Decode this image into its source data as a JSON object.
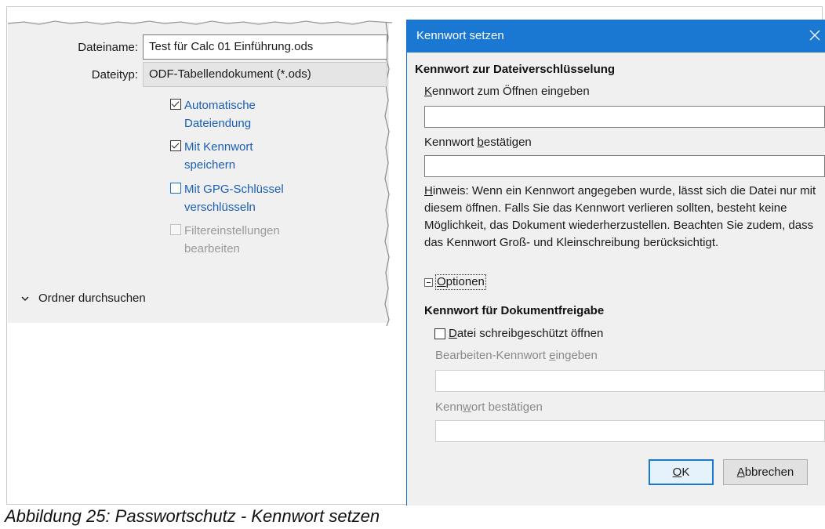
{
  "save_dialog": {
    "filename_label": "Dateiname:",
    "filename_value": "Test für Calc 01 Einführung.ods",
    "filetype_label": "Dateityp:",
    "filetype_value": "ODF-Tabellendokument (*.ods)",
    "options": [
      {
        "line1": "Automatische",
        "line2": "Dateiendung",
        "checked": true,
        "state": "enabled"
      },
      {
        "line1": "Mit Kennwort",
        "line2": "speichern",
        "checked": true,
        "state": "enabled"
      },
      {
        "line1": "Mit GPG-Schlüssel",
        "line2": "verschlüsseln",
        "checked": false,
        "state": "enabled"
      },
      {
        "line1": "Filtereinstellungen",
        "line2": "bearbeiten",
        "checked": false,
        "state": "disabled"
      }
    ],
    "browse_label": "Ordner durchsuchen"
  },
  "password_dialog": {
    "title": "Kennwort setzen",
    "section_encryption": "Kennwort zur Dateiverschlüsselung",
    "open_pw": {
      "mnemonic": "K",
      "rest": "ennwort zum Öffnen eingeben"
    },
    "confirm_pw": {
      "before": "Kennwort ",
      "mnemonic": "b",
      "after": "estätigen"
    },
    "note": {
      "mnemonic": "H",
      "rest": "inweis: Wenn ein Kennwort angegeben wurde, lässt sich die Datei nur mit diesem öffnen. Falls Sie das Kennwort verlieren sollten, besteht keine Möglichkeit, das Dokument wiederherzustellen. Beachten Sie zudem, dass das Kennwort Groß- und Kleinschreibung berücksichtigt."
    },
    "options_toggle": {
      "mnemonic": "O",
      "rest": "ptionen"
    },
    "section_sharing": "Kennwort für Dokumentfreigabe",
    "readonly_checkbox": {
      "mnemonic": "D",
      "rest": "atei schreibgeschützt öffnen",
      "checked": false
    },
    "edit_pw": {
      "before": "Bearbeiten-Kennwort ",
      "mnemonic": "e",
      "after": "ingeben"
    },
    "edit_confirm_pw": {
      "before": "Kenn",
      "mnemonic": "w",
      "after": "ort bestätigen"
    },
    "ok_button": {
      "mnemonic": "O",
      "rest": "K"
    },
    "cancel_button": {
      "mnemonic": "A",
      "rest": "bbrechen"
    }
  },
  "caption": "Abbildung 25: Passwortschutz - Kennwort setzen",
  "colors": {
    "accent": "#1a78d2",
    "link_blue": "#1a5fb4",
    "dialog_bg": "#f0f0f0"
  }
}
